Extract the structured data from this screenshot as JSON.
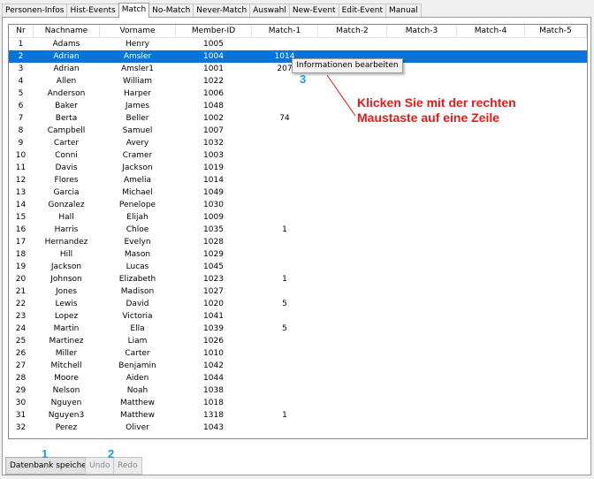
{
  "tabs": [
    "Personen-Infos",
    "Hist-Events",
    "Match",
    "No-Match",
    "Never-Match",
    "Auswahl",
    "New-Event",
    "Edit-Event",
    "Manual"
  ],
  "active_tab": "Match",
  "table": {
    "columns": [
      "Nr",
      "Nachname",
      "Vorname",
      "Member-ID",
      "Match-1",
      "Match-2",
      "Match-3",
      "Match-4",
      "Match-5"
    ],
    "rows": [
      [
        "1",
        "Adams",
        "Henry",
        "1005",
        "",
        "",
        "",
        "",
        ""
      ],
      [
        "2",
        "Adrian",
        "Amsler",
        "1004",
        "1014",
        "",
        "",
        "",
        ""
      ],
      [
        "3",
        "Adrian",
        "Amsler1",
        "1001",
        "207",
        "",
        "",
        "",
        ""
      ],
      [
        "4",
        "Allen",
        "William",
        "1022",
        "",
        "",
        "",
        "",
        ""
      ],
      [
        "5",
        "Anderson",
        "Harper",
        "1006",
        "",
        "",
        "",
        "",
        ""
      ],
      [
        "6",
        "Baker",
        "James",
        "1048",
        "",
        "",
        "",
        "",
        ""
      ],
      [
        "7",
        "Berta",
        "Beller",
        "1002",
        "74",
        "",
        "",
        "",
        ""
      ],
      [
        "8",
        "Campbell",
        "Samuel",
        "1007",
        "",
        "",
        "",
        "",
        ""
      ],
      [
        "9",
        "Carter",
        "Avery",
        "1032",
        "",
        "",
        "",
        "",
        ""
      ],
      [
        "10",
        "Conni",
        "Cramer",
        "1003",
        "",
        "",
        "",
        "",
        ""
      ],
      [
        "11",
        "Davis",
        "Jackson",
        "1019",
        "",
        "",
        "",
        "",
        ""
      ],
      [
        "12",
        "Flores",
        "Amelia",
        "1014",
        "",
        "",
        "",
        "",
        ""
      ],
      [
        "13",
        "Garcia",
        "Michael",
        "1049",
        "",
        "",
        "",
        "",
        ""
      ],
      [
        "14",
        "Gonzalez",
        "Penelope",
        "1030",
        "",
        "",
        "",
        "",
        ""
      ],
      [
        "15",
        "Hall",
        "Elijah",
        "1009",
        "",
        "",
        "",
        "",
        ""
      ],
      [
        "16",
        "Harris",
        "Chloe",
        "1035",
        "1",
        "",
        "",
        "",
        ""
      ],
      [
        "17",
        "Hernandez",
        "Evelyn",
        "1028",
        "",
        "",
        "",
        "",
        ""
      ],
      [
        "18",
        "Hill",
        "Mason",
        "1029",
        "",
        "",
        "",
        "",
        ""
      ],
      [
        "19",
        "Jackson",
        "Lucas",
        "1045",
        "",
        "",
        "",
        "",
        ""
      ],
      [
        "20",
        "Johnson",
        "Elizabeth",
        "1023",
        "1",
        "",
        "",
        "",
        ""
      ],
      [
        "21",
        "Jones",
        "Madison",
        "1027",
        "",
        "",
        "",
        "",
        ""
      ],
      [
        "22",
        "Lewis",
        "David",
        "1020",
        "5",
        "",
        "",
        "",
        ""
      ],
      [
        "23",
        "Lopez",
        "Victoria",
        "1041",
        "",
        "",
        "",
        "",
        ""
      ],
      [
        "24",
        "Martin",
        "Ella",
        "1039",
        "5",
        "",
        "",
        "",
        ""
      ],
      [
        "25",
        "Martinez",
        "Liam",
        "1026",
        "",
        "",
        "",
        "",
        ""
      ],
      [
        "26",
        "Miller",
        "Carter",
        "1010",
        "",
        "",
        "",
        "",
        ""
      ],
      [
        "27",
        "Mitchell",
        "Benjamin",
        "1042",
        "",
        "",
        "",
        "",
        ""
      ],
      [
        "28",
        "Moore",
        "Aiden",
        "1044",
        "",
        "",
        "",
        "",
        ""
      ],
      [
        "29",
        "Nelson",
        "Noah",
        "1038",
        "",
        "",
        "",
        "",
        ""
      ],
      [
        "30",
        "Nguyen",
        "Matthew",
        "1018",
        "",
        "",
        "",
        "",
        ""
      ],
      [
        "31",
        "Nguyen3",
        "Matthew",
        "1318",
        "1",
        "",
        "",
        "",
        ""
      ],
      [
        "32",
        "Perez",
        "Oliver",
        "1043",
        "",
        "",
        "",
        "",
        ""
      ]
    ],
    "selected_row": 1
  },
  "context_menu": {
    "item": "Informationen bearbeiten"
  },
  "annotation": {
    "text": "Klicken Sie mit der rechten Maustaste auf eine Zeile",
    "color": "#e61919"
  },
  "markers": {
    "m1": "1",
    "m2": "2",
    "m3": "3",
    "color": "#1e9bd7"
  },
  "buttons": {
    "save": "Datenbank speichern",
    "undo": "Undo",
    "redo": "Redo"
  },
  "colors": {
    "selection": "#0a74d6"
  }
}
